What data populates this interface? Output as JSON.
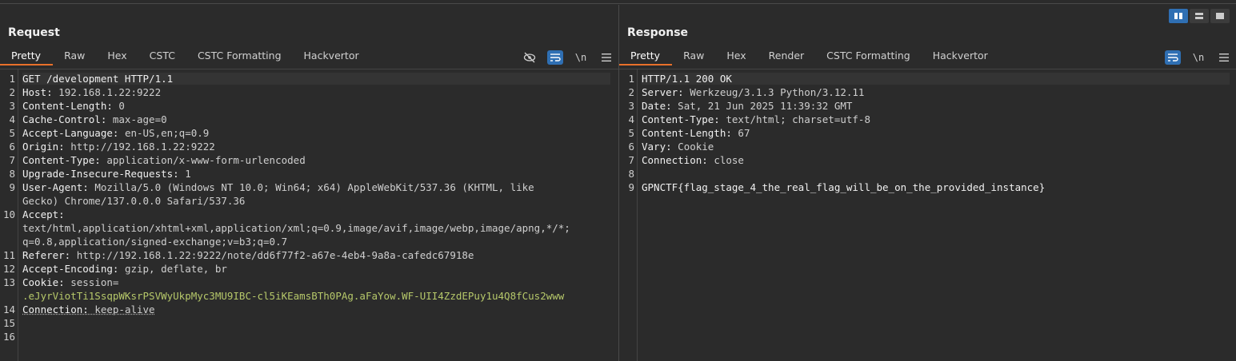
{
  "request": {
    "title": "Request",
    "tabs": [
      "Pretty",
      "Raw",
      "Hex",
      "CSTC",
      "CSTC Formatting",
      "Hackvertor"
    ],
    "tools": {
      "newline_label": "\\n"
    },
    "line_numbers": [
      "1",
      "2",
      "3",
      "4",
      "5",
      "6",
      "7",
      "8",
      "9",
      "10",
      "11",
      "12",
      "13",
      "14",
      "15",
      "16"
    ],
    "lines": {
      "l1": "GET /development HTTP/1.1",
      "l2k": "Host:",
      "l2v": " 192.168.1.22:9222",
      "l3k": "Content-Length:",
      "l3v": " 0",
      "l4k": "Cache-Control:",
      "l4v": " max-age=0",
      "l5k": "Accept-Language:",
      "l5v": " en-US,en;q=0.9",
      "l6k": "Origin:",
      "l6v": " http://192.168.1.22:9222",
      "l7k": "Content-Type:",
      "l7v": " application/x-www-form-urlencoded",
      "l8k": "Upgrade-Insecure-Requests:",
      "l8v": " 1",
      "l9k": "User-Agent:",
      "l9v": " Mozilla/5.0 (Windows NT 10.0; Win64; x64) AppleWebKit/537.36 (KHTML, like",
      "l9b": "Gecko) Chrome/137.0.0.0 Safari/537.36",
      "l10k": "Accept:",
      "l10a": "text/html,application/xhtml+xml,application/xml;q=0.9,image/avif,image/webp,image/apng,*/*;",
      "l10b": "q=0.8,application/signed-exchange;v=b3;q=0.7",
      "l11k": "Referer:",
      "l11v": " http://192.168.1.22:9222/note/dd6f77f2-a67e-4eb4-9a8a-cafedc67918e",
      "l12k": "Accept-Encoding:",
      "l12v": " gzip, deflate, br",
      "l13k": "Cookie:",
      "l13v": " session=",
      "l13b": ".eJyrViotTi1SsqpWKsrPSVWyUkpMyc3MU9IBC-cl5iKEamsBTh0PAg.aFaYow.WF-UII4ZzdEPuy1u4Q8fCus2www",
      "l14k": "Connection:",
      "l14v": " keep-alive"
    }
  },
  "response": {
    "title": "Response",
    "tabs": [
      "Pretty",
      "Raw",
      "Hex",
      "Render",
      "CSTC Formatting",
      "Hackvertor"
    ],
    "tools": {
      "newline_label": "\\n"
    },
    "line_numbers": [
      "1",
      "2",
      "3",
      "4",
      "5",
      "6",
      "7",
      "8",
      "9"
    ],
    "lines": {
      "l1": "HTTP/1.1 200 OK",
      "l2k": "Server:",
      "l2v": " Werkzeug/3.1.3 Python/3.12.11",
      "l3k": "Date:",
      "l3v": " Sat, 21 Jun 2025 11:39:32 GMT",
      "l4k": "Content-Type:",
      "l4v": " text/html; charset=utf-8",
      "l5k": "Content-Length:",
      "l5v": " 67",
      "l6k": "Vary:",
      "l6v": " Cookie",
      "l7k": "Connection:",
      "l7v": " close",
      "l9": "GPNCTF{flag_stage_4_the_real_flag_will_be_on_the_provided_instance}"
    }
  },
  "colors": {
    "accent": "#e8702a",
    "active_tool": "#2f6fb3",
    "cookie_value": "#b6c86a"
  },
  "icons": [
    "layout-split-horizontal-icon",
    "layout-split-vertical-icon",
    "layout-tabs-icon",
    "hide-icon",
    "wrap-icon",
    "newline-icon",
    "menu-icon"
  ]
}
